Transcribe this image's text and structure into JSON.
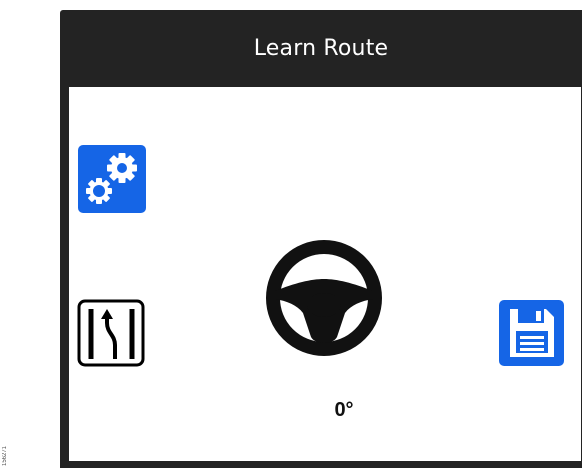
{
  "window": {
    "title": "Learn Route"
  },
  "figure": {
    "side_caption": "156271"
  },
  "controls": {
    "settings_icon": "gears-icon",
    "route_icon": "lane-change-icon",
    "save_icon": "floppy-disk-icon",
    "wheel_icon": "steering-wheel-icon"
  },
  "steering": {
    "angle_text": "0°"
  },
  "colors": {
    "frame": "#232323",
    "accent_blue": "#1565e6",
    "screen": "#ffffff",
    "title_text": "#ffffff",
    "wheel": "#111111"
  }
}
